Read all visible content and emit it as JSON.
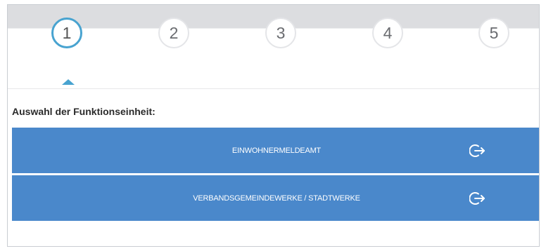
{
  "stepper": {
    "steps": [
      {
        "label": "1",
        "active": true
      },
      {
        "label": "2",
        "active": false
      },
      {
        "label": "3",
        "active": false
      },
      {
        "label": "4",
        "active": false
      },
      {
        "label": "5",
        "active": false
      }
    ]
  },
  "section": {
    "title": "Auswahl der Funktionseinheit:"
  },
  "options": [
    {
      "label": "EINWOHNERMELDEAMT",
      "icon": "logout-arrow-icon"
    },
    {
      "label": "VERBANDSGEMEINDEWERKE / STADTWERKE",
      "icon": "logout-arrow-icon"
    }
  ],
  "colors": {
    "accent": "#48a3d0",
    "button": "#4a88cb",
    "band": "#dcdde0"
  }
}
